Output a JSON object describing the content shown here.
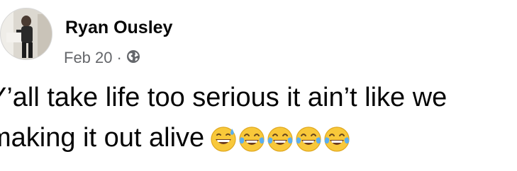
{
  "post": {
    "author": "Ryan Ousley",
    "date": "Feb 20",
    "separator": "·",
    "audience_icon": "globe-icon",
    "text_line1": "Y’all take life too serious it ain’t like we",
    "text_line2": "making it out alive",
    "emojis": [
      "grinning-sweat-emoji",
      "tears-of-joy-emoji",
      "tears-of-joy-emoji",
      "tears-of-joy-emoji",
      "tears-of-joy-emoji"
    ]
  },
  "colors": {
    "text_primary": "#050505",
    "text_secondary": "#65676b",
    "emoji_face": "#f8c83a",
    "emoji_tear": "#5aaef0"
  }
}
